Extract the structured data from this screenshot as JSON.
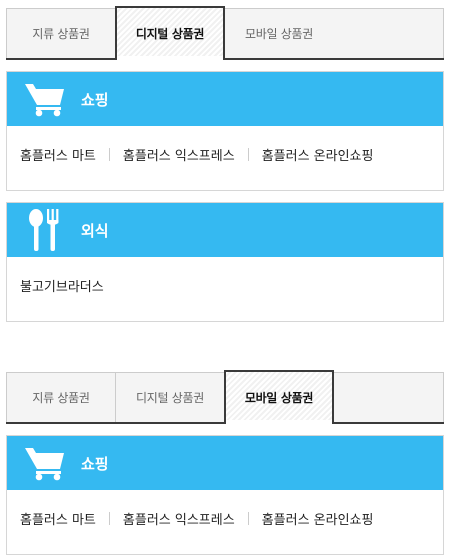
{
  "tabs": [
    "지류 상품권",
    "디지털 상품권",
    "모바일 상품권"
  ],
  "widgets": [
    {
      "active_tab": 1,
      "cards": [
        {
          "title": "쇼핑",
          "icon": "shopping-cart-icon",
          "items": [
            "홈플러스 마트",
            "홈플러스 익스프레스",
            "홈플러스 온라인쇼핑"
          ]
        },
        {
          "title": "외식",
          "icon": "fork-spoon-icon",
          "items": [
            "불고기브라더스"
          ]
        }
      ]
    },
    {
      "active_tab": 2,
      "cards": [
        {
          "title": "쇼핑",
          "icon": "shopping-cart-icon",
          "items": [
            "홈플러스 마트",
            "홈플러스 익스프레스",
            "홈플러스 온라인쇼핑"
          ]
        }
      ]
    }
  ],
  "colors": {
    "accent": "#35b9f1",
    "tab_border": "#3a3a3a",
    "tab_bg": "#f4f4f4"
  }
}
